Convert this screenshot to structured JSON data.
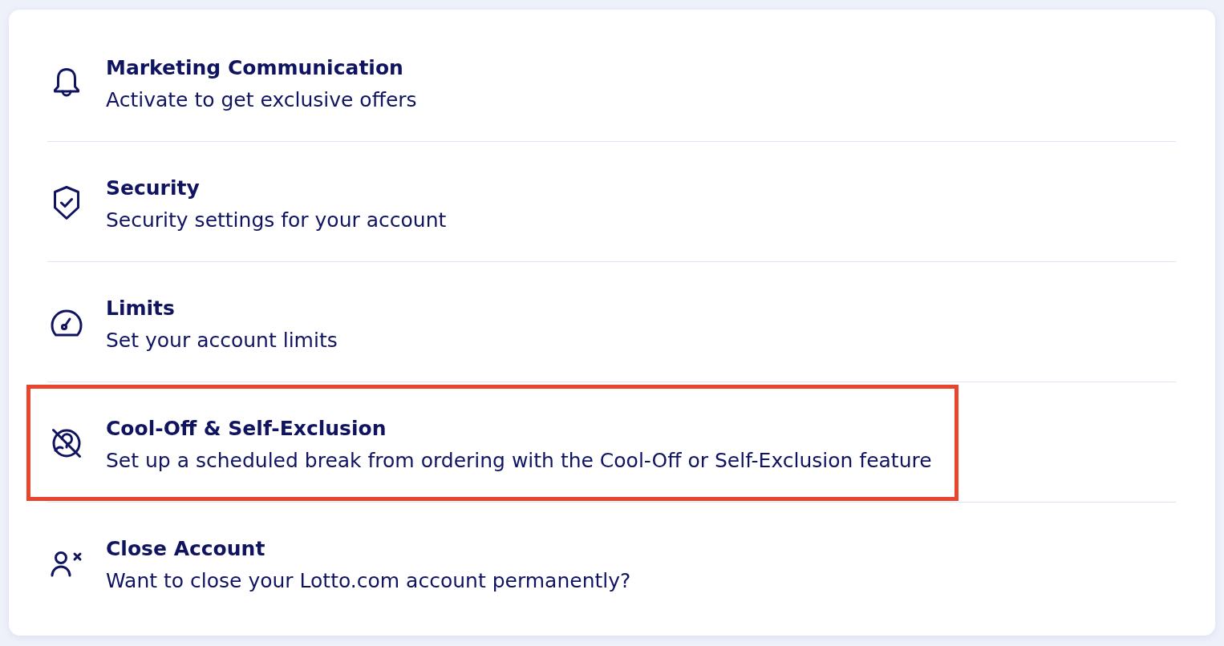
{
  "items": [
    {
      "title": "Marketing Communication",
      "description": "Activate to get exclusive offers",
      "highlighted": false
    },
    {
      "title": "Security",
      "description": "Security settings for your account",
      "highlighted": false
    },
    {
      "title": "Limits",
      "description": "Set your account limits",
      "highlighted": false
    },
    {
      "title": "Cool-Off & Self-Exclusion",
      "description": "Set up a scheduled break from ordering with the Cool-Off or Self-Exclusion feature",
      "highlighted": true
    },
    {
      "title": "Close Account",
      "description": "Want to close your Lotto.com account permanently?",
      "highlighted": false
    }
  ]
}
